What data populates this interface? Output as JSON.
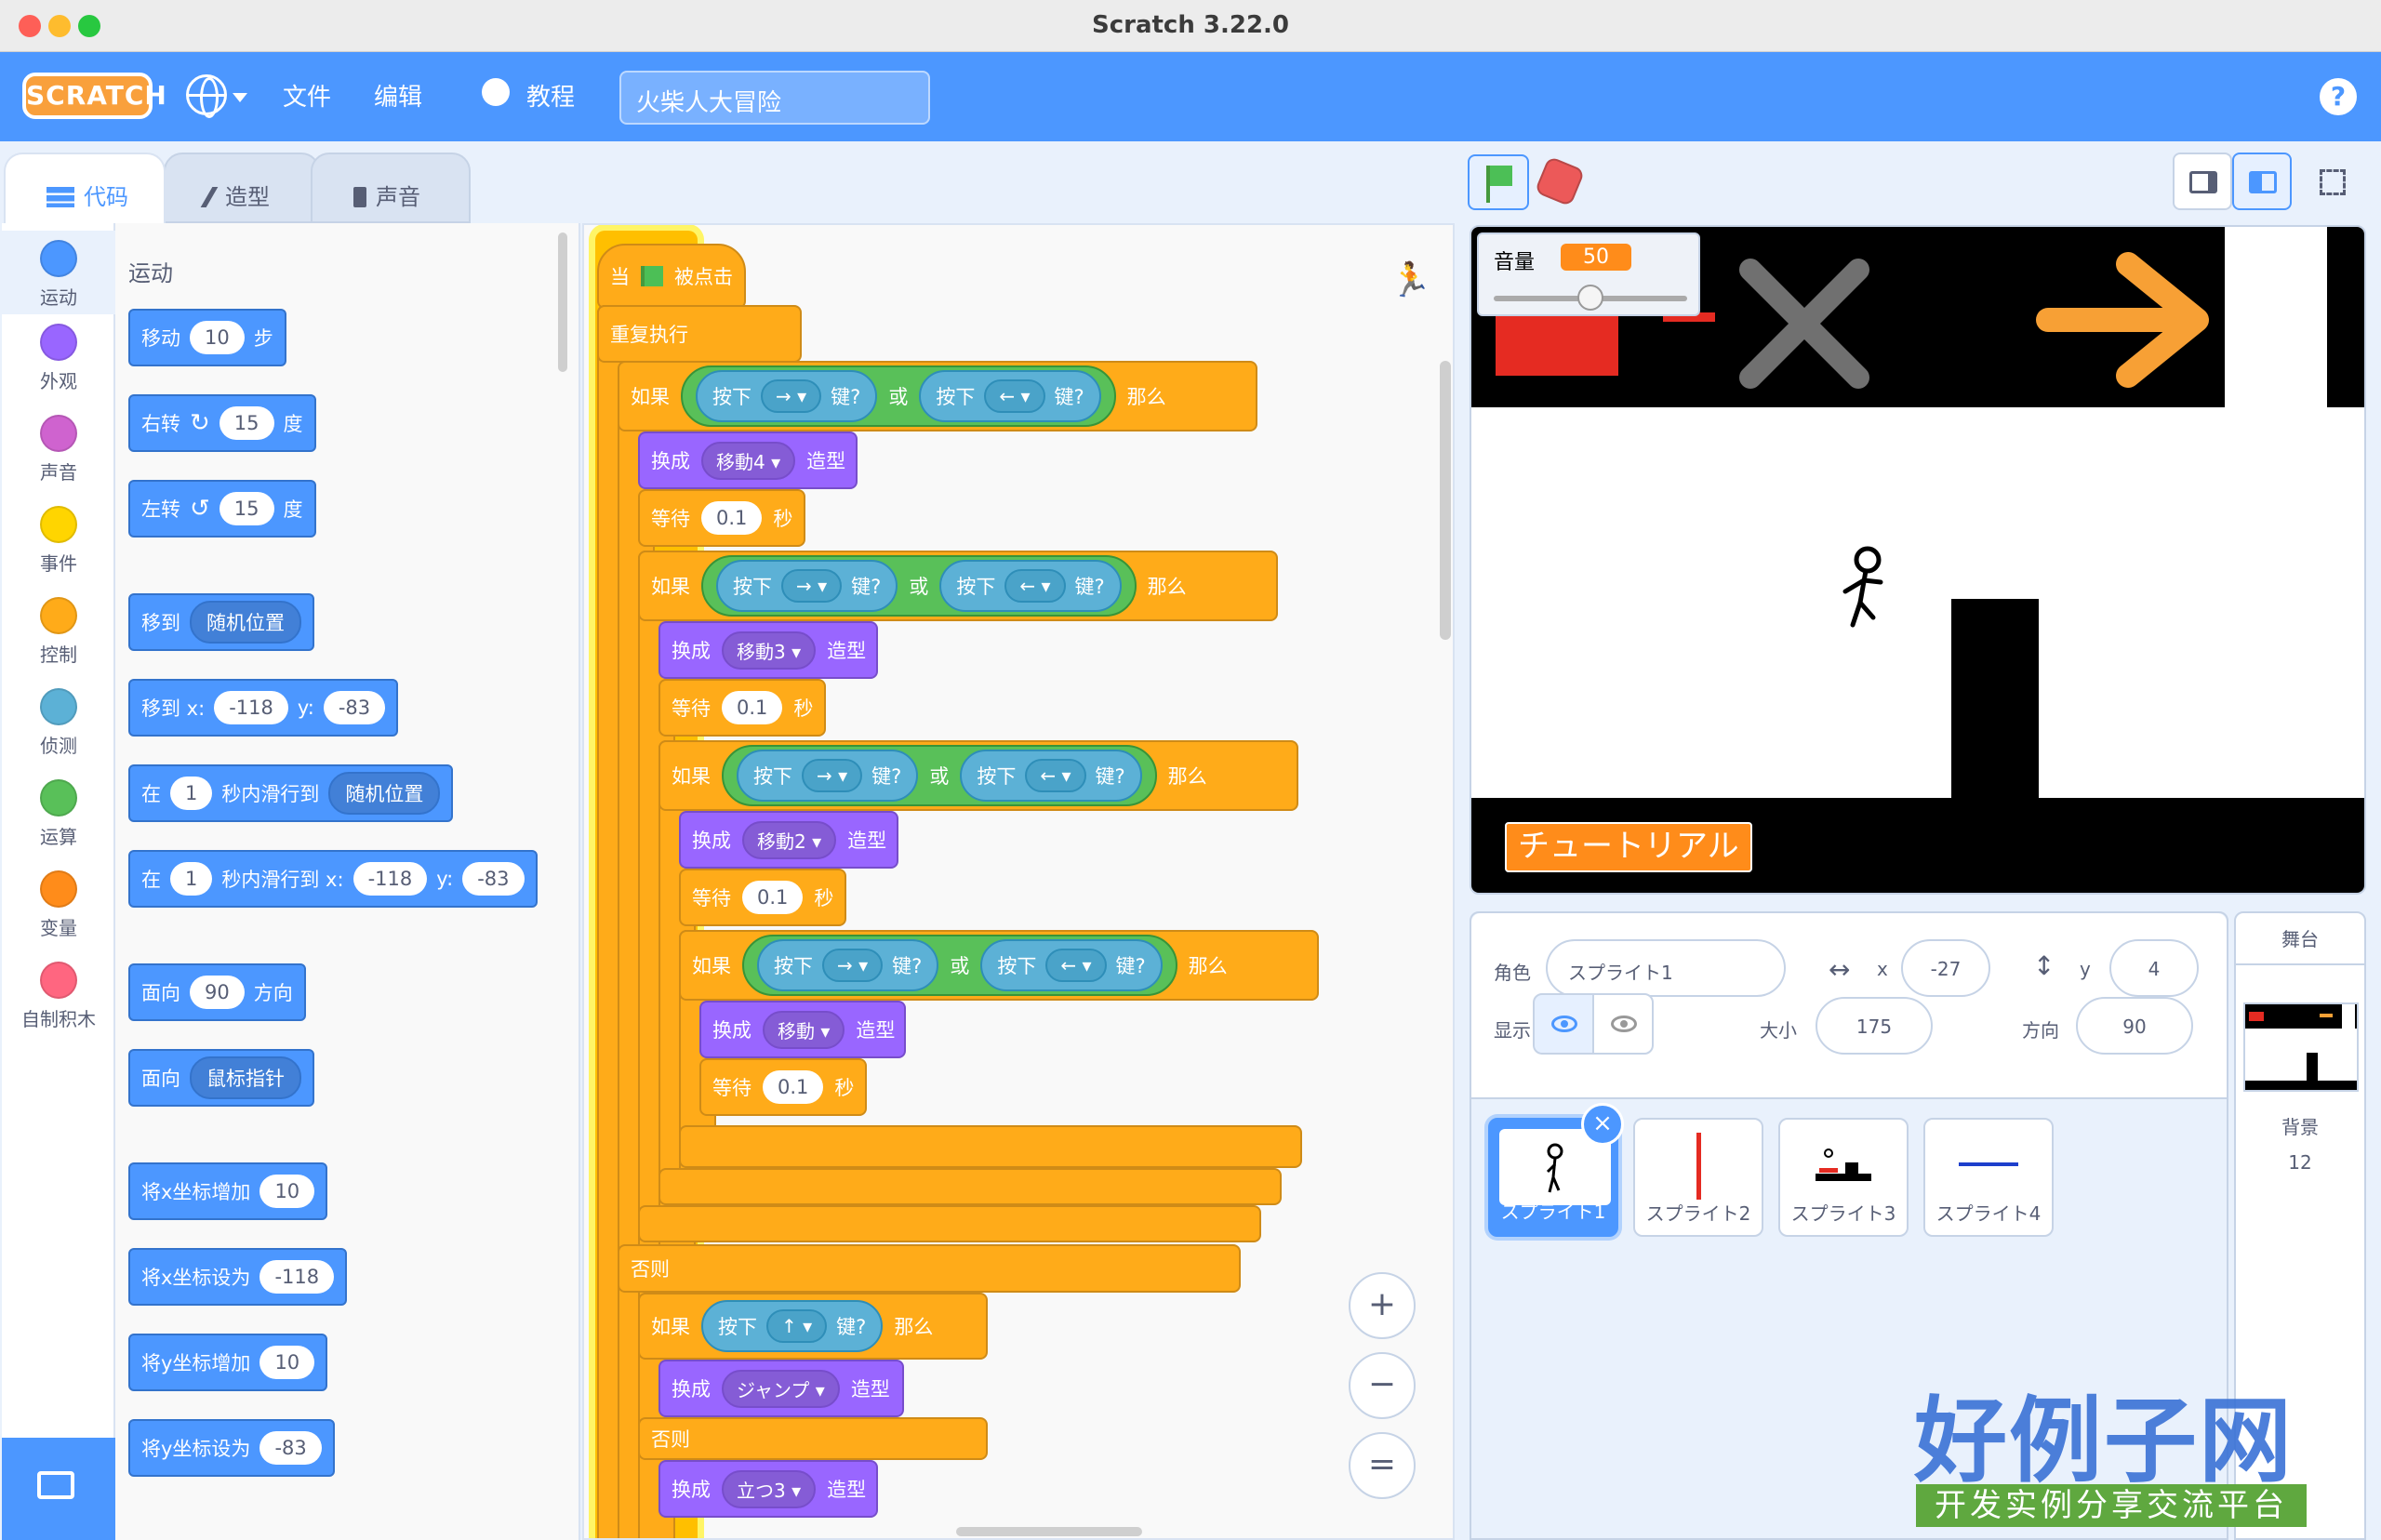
{
  "window": {
    "title": "Scratch 3.22.0"
  },
  "menubar": {
    "logo": "SCRATCH",
    "file": "文件",
    "edit": "编辑",
    "tutorials": "教程",
    "project_title": "火柴人大冒险",
    "help": "?"
  },
  "tabs": {
    "code": "代码",
    "costumes": "造型",
    "sounds": "声音"
  },
  "categories": [
    {
      "label": "运动",
      "color": "#4c97ff"
    },
    {
      "label": "外观",
      "color": "#9966ff"
    },
    {
      "label": "声音",
      "color": "#cf63cf"
    },
    {
      "label": "事件",
      "color": "#ffd500"
    },
    {
      "label": "控制",
      "color": "#ffab19"
    },
    {
      "label": "侦测",
      "color": "#5cb1d6"
    },
    {
      "label": "运算",
      "color": "#59c059"
    },
    {
      "label": "变量",
      "color": "#ff8c1a"
    },
    {
      "label": "自制积木",
      "color": "#ff6680"
    }
  ],
  "palette": {
    "title": "运动",
    "move": {
      "a": "移动",
      "v": "10",
      "b": "步"
    },
    "turn_right": {
      "a": "右转",
      "icon": "↻",
      "v": "15",
      "b": "度"
    },
    "turn_left": {
      "a": "左转",
      "icon": "↺",
      "v": "15",
      "b": "度"
    },
    "goto": {
      "a": "移到",
      "dd": "随机位置"
    },
    "goto_xy": {
      "a": "移到 x:",
      "x": "-118",
      "yl": "y:",
      "y": "-83"
    },
    "glide": {
      "a": "在",
      "v": "1",
      "b": "秒内滑行到",
      "dd": "随机位置"
    },
    "glide_xy": {
      "a": "在",
      "v": "1",
      "b": "秒内滑行到 x:",
      "x": "-118",
      "yl": "y:",
      "y": "-83"
    },
    "point": {
      "a": "面向",
      "v": "90",
      "b": "方向"
    },
    "point_toward": {
      "a": "面向",
      "dd": "鼠标指针"
    },
    "change_x": {
      "a": "将x坐标增加",
      "v": "10"
    },
    "set_x": {
      "a": "将x坐标设为",
      "v": "-118"
    },
    "change_y": {
      "a": "将y坐标增加",
      "v": "10"
    },
    "set_y": {
      "a": "将y坐标设为",
      "v": "-83"
    }
  },
  "script": {
    "when": "当",
    "clicked": "被点击",
    "forever": "重复执行",
    "if": "如果",
    "then": "那么",
    "else": "否则",
    "or": "或",
    "press": "按下",
    "key_q": "键?",
    "switch": "换成",
    "costume": "造型",
    "wait": "等待",
    "sec": "秒",
    "right": "→",
    "left": "←",
    "up": "↑",
    "wait_val": "0.1",
    "costumes": [
      "移動4",
      "移動3",
      "移動2",
      "移動",
      "ジャンプ",
      "立つ3"
    ]
  },
  "zoom": {
    "in": "+",
    "out": "−",
    "reset": "="
  },
  "stage": {
    "volume_label": "音量",
    "volume_value": "50",
    "volume_level": 0.5,
    "tutorial": "チュートリアル"
  },
  "sprite_info": {
    "sprite_label": "角色",
    "sprite_name": "スプライト1",
    "x_label": "x",
    "x": "-27",
    "y_label": "y",
    "y": "4",
    "show_label": "显示",
    "size_label": "大小",
    "size": "175",
    "direction_label": "方向",
    "direction": "90"
  },
  "sprites": [
    "スプライト1",
    "スプライト2",
    "スプライト3",
    "スプライト4"
  ],
  "stage_pane": {
    "header": "舞台",
    "backdrop_label": "背景",
    "backdrop_count": "12"
  },
  "watermark": {
    "title": "好例子网",
    "subtitle": "开发实例分享交流平台"
  }
}
